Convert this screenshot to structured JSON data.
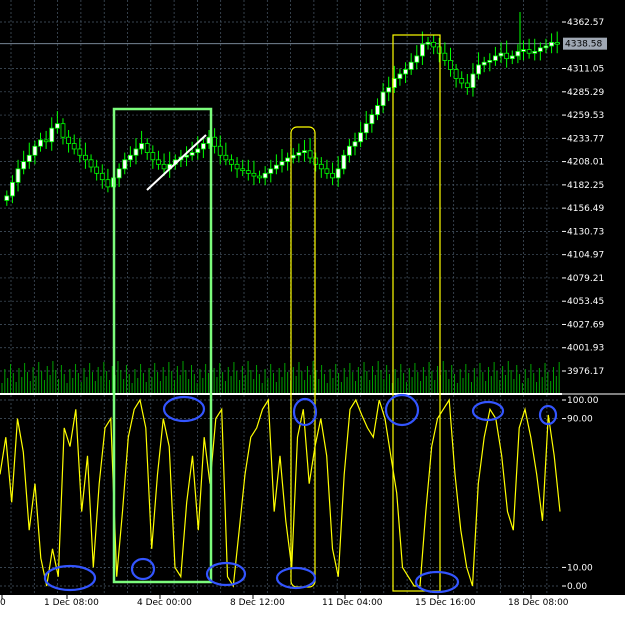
{
  "price_axis": {
    "ticks": [
      "4362.57",
      "4311.05",
      "4285.29",
      "4259.53",
      "4233.77",
      "4208.01",
      "4182.25",
      "4156.49",
      "4130.73",
      "4104.97",
      "4079.21",
      "4053.45",
      "4027.69",
      "4001.93",
      "3976.17"
    ],
    "current_price": "4338.58"
  },
  "oscillator_axis": {
    "ticks": [
      "100.00",
      "90.00",
      "10.00",
      "0.00"
    ]
  },
  "time_axis": {
    "labels": [
      "0",
      "1 Dec 08:00",
      "4 Dec 00:00",
      "8 Dec 12:00",
      "11 Dec 04:00",
      "15 Dec 16:00",
      "18 Dec 08:00"
    ]
  },
  "colors": {
    "background": "#000000",
    "grid": "#4a5a6a",
    "bull_candle": "#ffffff",
    "bear_candle": "#000000",
    "wick": "#00ff00",
    "volume": "#00a000",
    "oscillator": "#ffff00",
    "green_box": "#7cfc7c",
    "yellow_box": "#ffff00",
    "circle": "#3355ff",
    "axis_bg": "#000000",
    "axis_text": "#ffffff"
  },
  "chart_data": {
    "type": "line",
    "title": "",
    "ylim_price": [
      3960,
      4375
    ],
    "ylim_osc": [
      -5,
      105
    ],
    "price_close": [
      4170,
      4185,
      4200,
      4208,
      4215,
      4225,
      4232,
      4230,
      4245,
      4250,
      4235,
      4228,
      4222,
      4215,
      4210,
      4202,
      4195,
      4188,
      4180,
      4190,
      4200,
      4210,
      4215,
      4222,
      4228,
      4218,
      4210,
      4205,
      4200,
      4205,
      4210,
      4213,
      4215,
      4218,
      4222,
      4228,
      4235,
      4225,
      4215,
      4210,
      4205,
      4200,
      4198,
      4195,
      4192,
      4190,
      4195,
      4200,
      4204,
      4208,
      4212,
      4215,
      4218,
      4220,
      4212,
      4205,
      4200,
      4195,
      4190,
      4200,
      4215,
      4225,
      4230,
      4240,
      4250,
      4260,
      4270,
      4285,
      4290,
      4300,
      4305,
      4310,
      4318,
      4325,
      4338,
      4340,
      4335,
      4328,
      4320,
      4310,
      4300,
      4295,
      4290,
      4305,
      4315,
      4318,
      4320,
      4325,
      4328,
      4322,
      4325,
      4330,
      4332,
      4328,
      4330,
      4334,
      4336,
      4340,
      4338
    ],
    "oscillator": [
      60,
      80,
      45,
      90,
      72,
      30,
      55,
      15,
      0,
      20,
      5,
      85,
      75,
      95,
      40,
      70,
      10,
      55,
      85,
      90,
      5,
      40,
      80,
      95,
      100,
      85,
      20,
      60,
      90,
      75,
      10,
      5,
      45,
      70,
      30,
      80,
      55,
      90,
      95,
      5,
      0,
      30,
      60,
      80,
      85,
      95,
      100,
      40,
      70,
      35,
      10,
      80,
      95,
      55,
      75,
      90,
      70,
      20,
      5,
      60,
      95,
      100,
      92,
      85,
      80,
      100,
      90,
      70,
      50,
      10,
      5,
      0,
      0,
      40,
      75,
      90,
      95,
      100,
      60,
      30,
      10,
      0,
      55,
      80,
      95,
      90,
      70,
      40,
      30,
      85,
      95,
      80,
      60,
      35,
      92,
      70,
      40
    ]
  }
}
